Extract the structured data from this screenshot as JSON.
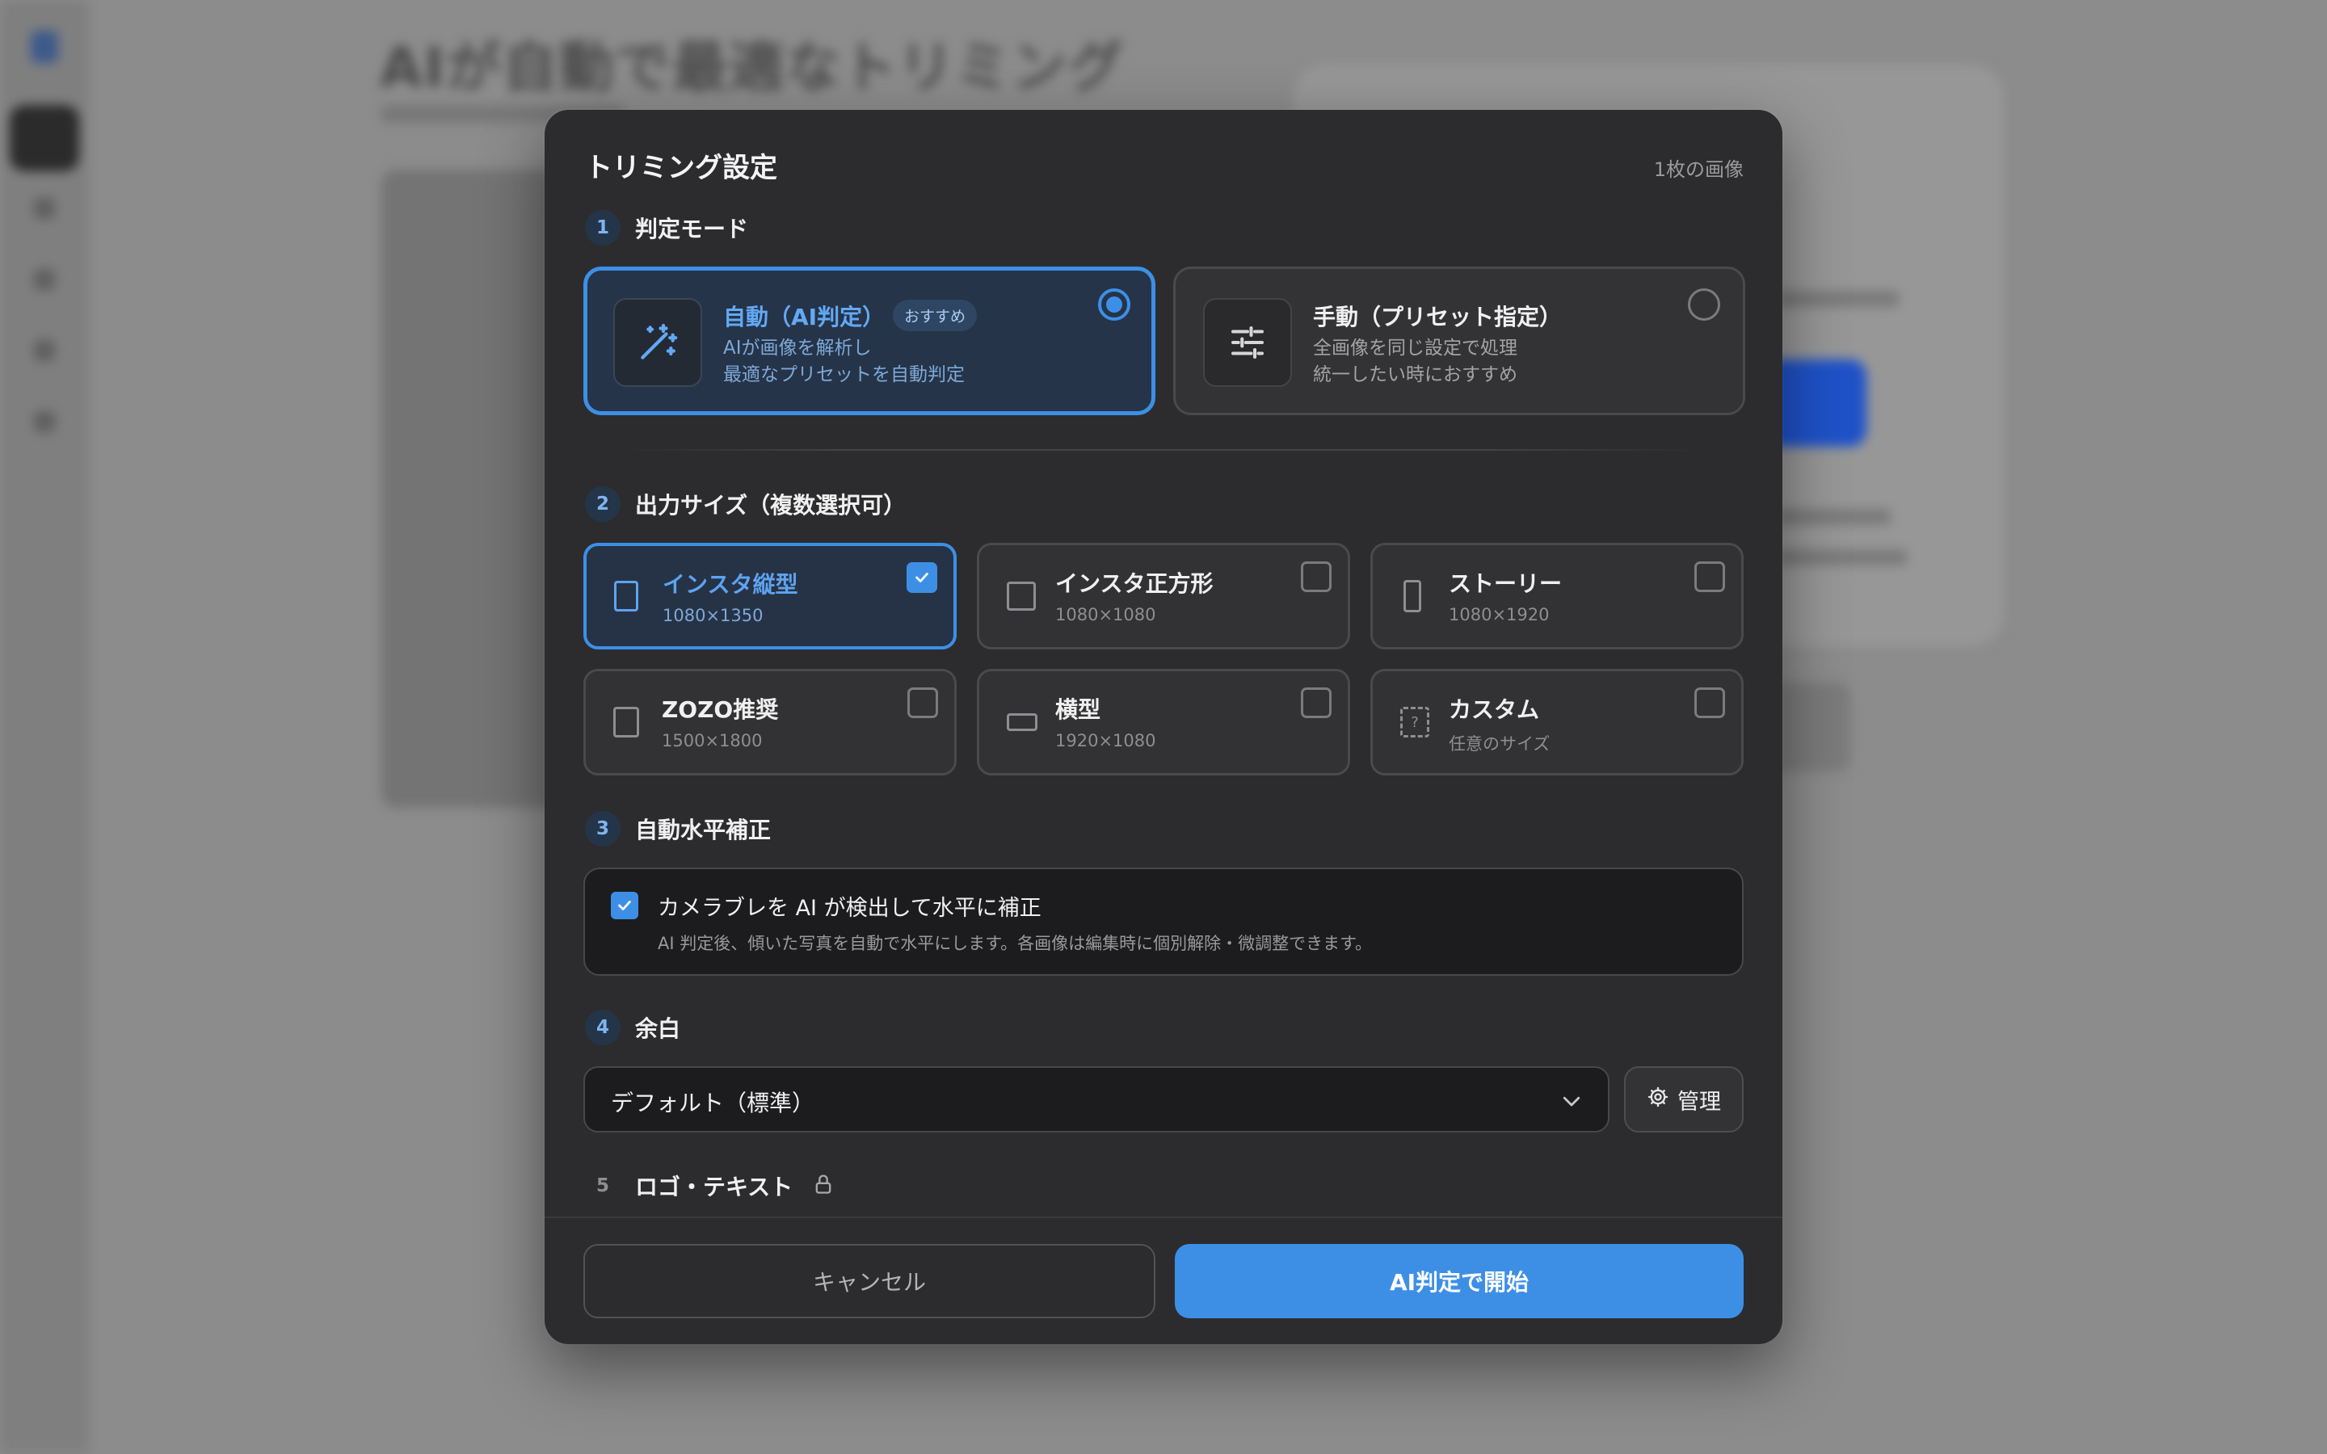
{
  "background": {
    "page_title": "AIが自動で最適なトリミング"
  },
  "modal": {
    "title": "トリミング設定",
    "image_count": "1枚の画像",
    "sections": {
      "mode": {
        "num": "1",
        "label": "判定モード"
      },
      "size": {
        "num": "2",
        "label": "出力サイズ（複数選択可）"
      },
      "level": {
        "num": "3",
        "label": "自動水平補正"
      },
      "margin": {
        "num": "4",
        "label": "余白"
      },
      "logo": {
        "num": "5",
        "label": "ロゴ・テキスト"
      }
    },
    "modes": [
      {
        "name": "自動（AI判定）",
        "badge": "おすすめ",
        "desc1": "AIが画像を解析し",
        "desc2": "最適なプリセットを自動判定",
        "selected": true,
        "icon": "magic-wand-icon"
      },
      {
        "name": "手動（プリセット指定）",
        "desc1": "全画像を同じ設定で処理",
        "desc2": "統一したい時におすすめ",
        "selected": false,
        "icon": "sliders-icon"
      }
    ],
    "sizes": [
      {
        "name": "インスタ縦型",
        "dim": "1080×1350",
        "checked": true
      },
      {
        "name": "インスタ正方形",
        "dim": "1080×1080",
        "checked": false
      },
      {
        "name": "ストーリー",
        "dim": "1080×1920",
        "checked": false
      },
      {
        "name": "ZOZO推奨",
        "dim": "1500×1800",
        "checked": false
      },
      {
        "name": "横型",
        "dim": "1920×1080",
        "checked": false
      },
      {
        "name": "カスタム",
        "dim": "任意のサイズ",
        "checked": false
      }
    ],
    "level": {
      "title": "カメラブレを AI が検出して水平に補正",
      "desc": "AI 判定後、傾いた写真を自動で水平にします。各画像は編集時に個別解除・微調整できます。",
      "checked": true
    },
    "margin": {
      "value": "デフォルト（標準）",
      "manage_label": "管理"
    },
    "footer": {
      "cancel_label": "キャンセル",
      "start_label": "AI判定で開始"
    },
    "colors": {
      "accent": "#3d8fe6",
      "modal_bg": "#2c2c2e"
    }
  }
}
